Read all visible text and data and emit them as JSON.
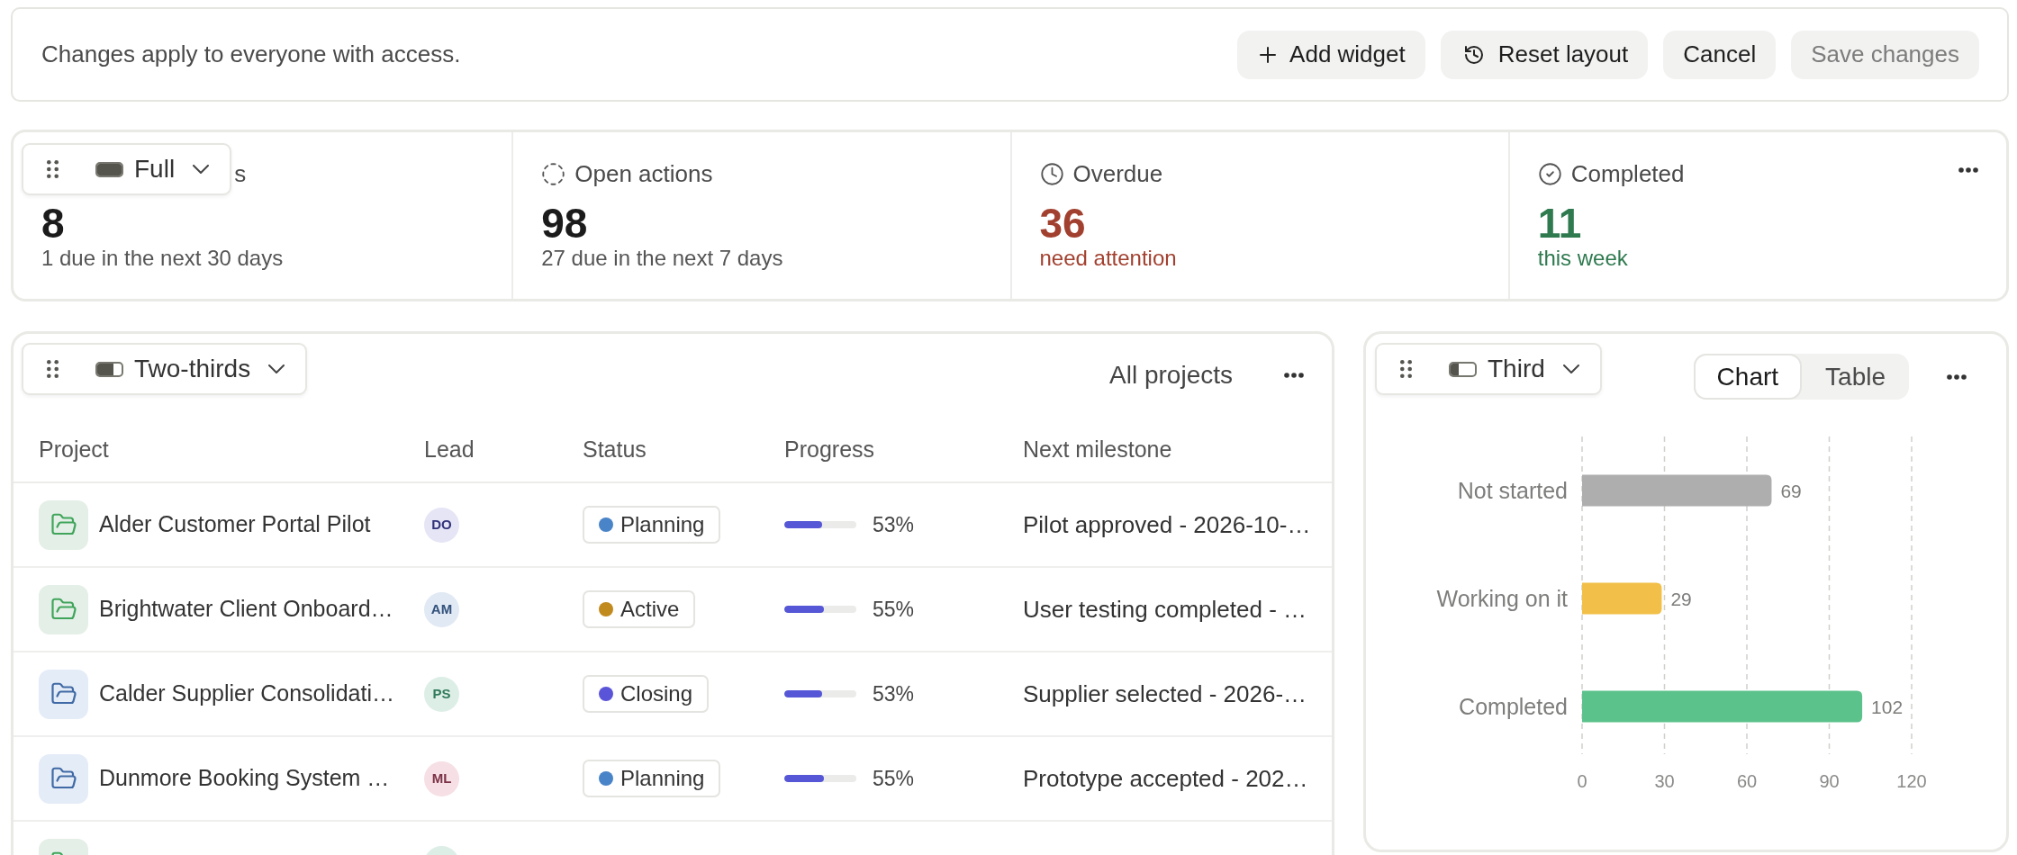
{
  "notice_bar": {
    "message": "Changes apply to everyone with access.",
    "buttons": [
      {
        "kind": "add",
        "label": "Add widget",
        "disabled": false
      },
      {
        "kind": "reset",
        "label": "Reset layout",
        "disabled": false
      },
      {
        "kind": "plain",
        "label": "Cancel",
        "disabled": false
      },
      {
        "kind": "plain",
        "label": "Save changes",
        "disabled": true
      }
    ]
  },
  "stats_widget": {
    "layout_menu": {
      "label": "Full",
      "level": 1
    },
    "items": [
      {
        "kind": "plain",
        "label": "s",
        "value": "8",
        "note": "1 due in the next 30 days"
      },
      {
        "kind": "open",
        "label": "Open actions",
        "value": "98",
        "note": "27 due in the next 7 days"
      },
      {
        "kind": "overdue",
        "label": "Overdue",
        "value": "36",
        "note": "need attention",
        "color": "#a2402f"
      },
      {
        "kind": "done",
        "label": "Completed",
        "value": "11",
        "note": "this week",
        "color": "#2f7a4f"
      }
    ]
  },
  "projects_widget": {
    "layout_menu": {
      "label": "Two-thirds",
      "level": 0.67
    },
    "filter": "All projects",
    "columns": [
      "Project",
      "Lead",
      "Status",
      "Progress",
      "Next milestone"
    ],
    "rows": [
      {
        "project": {
          "name": "Alder Customer Portal Pilot",
          "color": "#e4efe7"
        },
        "lead": {
          "initials": "DO",
          "color": "#e5e5f6"
        },
        "status": {
          "label": "Planning",
          "color": "#4a84c8"
        },
        "progress": {
          "level": 0.53,
          "reading": "53%"
        },
        "milestone": "Pilot approved - 2026-10-…"
      },
      {
        "project": {
          "name": "Brightwater Client Onboard…",
          "color": "#e4efe7"
        },
        "lead": {
          "initials": "AM",
          "color": "#e1e9f4"
        },
        "status": {
          "label": "Active",
          "color": "#c08a1e"
        },
        "progress": {
          "level": 0.55,
          "reading": "55%"
        },
        "milestone": "User testing completed - …"
      },
      {
        "project": {
          "name": "Calder Supplier Consolidati…",
          "color": "#e4ecf7"
        },
        "lead": {
          "initials": "PS",
          "color": "#ddeee7"
        },
        "status": {
          "label": "Closing",
          "color": "#5a55d8"
        },
        "progress": {
          "level": 0.53,
          "reading": "53%"
        },
        "milestone": "Supplier selected - 2026-…"
      },
      {
        "project": {
          "name": "Dunmore Booking System …",
          "color": "#e4ecf7"
        },
        "lead": {
          "initials": "ML",
          "color": "#f6dfe5"
        },
        "status": {
          "label": "Planning",
          "color": "#4a84c8"
        },
        "progress": {
          "level": 0.55,
          "reading": "55%"
        },
        "milestone": "Prototype accepted - 202…"
      },
      {
        "project": {
          "color": "#e4efe7"
        },
        "lead": {
          "color": "#ddeee7"
        }
      }
    ]
  },
  "status_widget": {
    "layout_menu": {
      "label": "Third",
      "level": 0.33
    },
    "tabs": [
      {
        "label": "Chart",
        "selected": true
      },
      {
        "label": "Table",
        "selected": false
      }
    ],
    "chart_data": {
      "type": "bar",
      "orientation": "horizontal",
      "categories": [
        "Not started",
        "Working on it",
        "Completed"
      ],
      "values": [
        69,
        29,
        102
      ],
      "colors": [
        "#aeaeae",
        "#f2c048",
        "#5cc28c"
      ],
      "xlim": [
        0,
        120
      ],
      "xticks": [
        0,
        30,
        60,
        90,
        120
      ],
      "grid": true,
      "data_labels": true
    }
  }
}
